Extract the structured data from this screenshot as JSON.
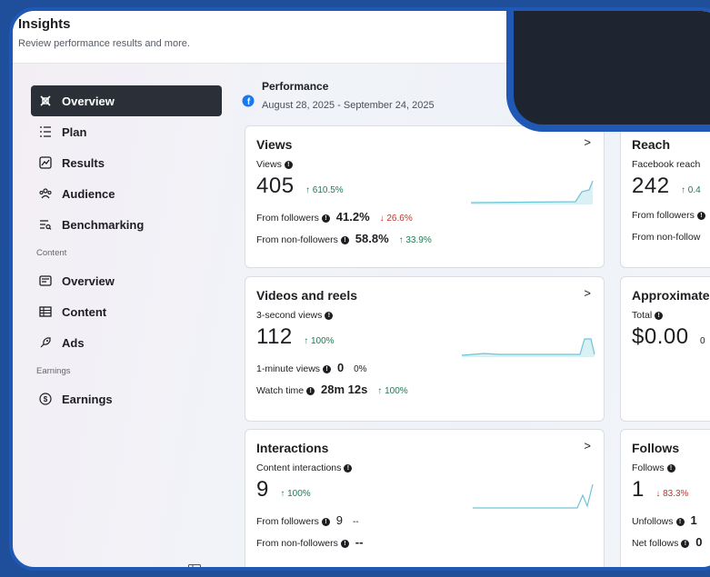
{
  "header": {
    "title": "Insights",
    "subtitle": "Review performance results and more."
  },
  "sidebar": {
    "items": [
      {
        "label": "Overview",
        "icon": "overview-icon",
        "active": true
      },
      {
        "label": "Plan",
        "icon": "plan-icon"
      },
      {
        "label": "Results",
        "icon": "results-icon"
      },
      {
        "label": "Audience",
        "icon": "audience-icon"
      },
      {
        "label": "Benchmarking",
        "icon": "benchmarking-icon"
      }
    ],
    "content_section": "Content",
    "content_items": [
      {
        "label": "Overview",
        "icon": "content-overview-icon"
      },
      {
        "label": "Content",
        "icon": "content-grid-icon"
      },
      {
        "label": "Ads",
        "icon": "ads-icon"
      }
    ],
    "earnings_section": "Earnings",
    "earnings_items": [
      {
        "label": "Earnings",
        "icon": "dollar-icon"
      }
    ]
  },
  "performance": {
    "title": "Performance",
    "dates": "August 28, 2025 - September 24, 2025"
  },
  "cards": {
    "views": {
      "title": "Views",
      "sub": "Views",
      "value": "405",
      "change": "↑ 610.5%",
      "line1_label": "From followers",
      "line1_value": "41.2%",
      "line1_change": "↓ 26.6%",
      "line2_label": "From non-followers",
      "line2_value": "58.8%",
      "line2_change": "↑ 33.9%"
    },
    "videos": {
      "title": "Videos and reels",
      "sub": "3-second views",
      "value": "112",
      "change": "↑ 100%",
      "line1_label": "1-minute views",
      "line1_value": "0",
      "line1_change": "0%",
      "line2_label": "Watch time",
      "line2_value": "28m 12s",
      "line2_change": "↑ 100%"
    },
    "interactions": {
      "title": "Interactions",
      "sub": "Content interactions",
      "value": "9",
      "change": "↑ 100%",
      "line1_label": "From followers",
      "line1_value": "9",
      "line1_change": "--",
      "line2_label": "From non-followers",
      "line2_value": "--"
    },
    "reach": {
      "title": "Reach",
      "sub": "Facebook reach",
      "value": "242",
      "change": "↑ 0.4",
      "line1_label": "From followers",
      "line2_label": "From non-follow"
    },
    "approx": {
      "title": "Approximate",
      "sub": "Total",
      "value": "$0.00",
      "change": "0"
    },
    "follows": {
      "title": "Follows",
      "sub": "Follows",
      "value": "1",
      "change": "↓ 83.3%",
      "line1_label": "Unfollows",
      "line1_value": "1",
      "line2_label": "Net follows",
      "line2_value": "0"
    }
  },
  "colors": {
    "accent_blue": "#1f59b5",
    "active_nav": "#2b3038",
    "up": "#1f7a54",
    "down": "#c0362c",
    "spark": "#6fc3d6"
  }
}
